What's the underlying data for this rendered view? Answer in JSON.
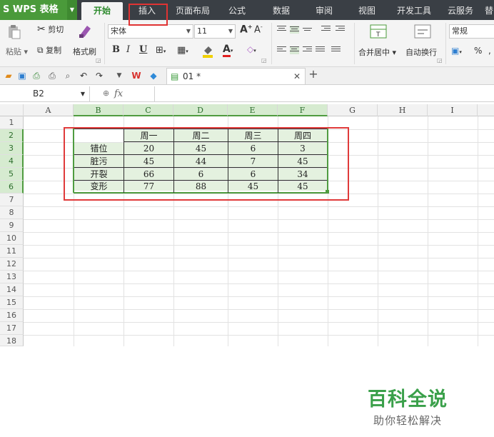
{
  "app": {
    "name": "S WPS 表格"
  },
  "tabs": [
    {
      "label": "开始",
      "active": true
    },
    {
      "label": "插入",
      "active": false
    },
    {
      "label": "页面布局",
      "active": false
    },
    {
      "label": "公式",
      "active": false
    },
    {
      "label": "数据",
      "active": false
    },
    {
      "label": "审阅",
      "active": false
    },
    {
      "label": "视图",
      "active": false
    },
    {
      "label": "开发工具",
      "active": false
    },
    {
      "label": "云服务",
      "active": false
    },
    {
      "label": "替",
      "active": false
    }
  ],
  "ribbon": {
    "paste": "粘贴",
    "cut": "剪切",
    "copy": "复制",
    "format_painter": "格式刷",
    "font_name": "宋体",
    "font_size": "11",
    "merge_center": "合并居中",
    "wrap_text": "自动换行",
    "number_format": "常规",
    "percent": "%"
  },
  "doc": {
    "tab_name": "01 *"
  },
  "formula_bar": {
    "name_box": "B2",
    "fx": "fx"
  },
  "grid": {
    "columns": [
      "A",
      "B",
      "C",
      "D",
      "E",
      "F",
      "G",
      "H",
      "I"
    ],
    "rows": [
      "1",
      "2",
      "3",
      "4",
      "5",
      "6",
      "7",
      "8",
      "9",
      "10",
      "11",
      "12",
      "13",
      "14",
      "15",
      "16",
      "17",
      "18"
    ],
    "header": [
      "",
      "周一",
      "周二",
      "周三",
      "周四"
    ],
    "data": [
      [
        "错位",
        "20",
        "45",
        "6",
        "3"
      ],
      [
        "脏污",
        "45",
        "44",
        "7",
        "45"
      ],
      [
        "开裂",
        "66",
        "6",
        "6",
        "34"
      ],
      [
        "变形",
        "77",
        "88",
        "45",
        "45"
      ]
    ]
  },
  "watermark": {
    "title": "百科全说",
    "subtitle": "助你轻松解决"
  },
  "colors": {
    "accent": "#4a9a3a",
    "highlight": "#e03333",
    "selection": "#e4f1df"
  }
}
